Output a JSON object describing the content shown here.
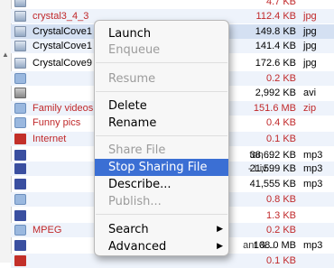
{
  "files": [
    {
      "name": "",
      "size": "4.7 KB",
      "type": "",
      "icon": "image-icon",
      "style": "red"
    },
    {
      "name": "crystal3_4_3",
      "size": "112.4 KB",
      "type": "jpg",
      "icon": "image-icon",
      "style": "red"
    },
    {
      "name": "CrystalCove1",
      "size": "149.8 KB",
      "type": "jpg",
      "icon": "image-icon",
      "style": "normal"
    },
    {
      "name": "CrystalCove1",
      "size": "141.4 KB",
      "type": "jpg",
      "icon": "image-icon",
      "style": "normal"
    },
    {
      "name": "CrystalCove9",
      "size": "172.6 KB",
      "type": "jpg",
      "icon": "image-icon",
      "style": "normal"
    },
    {
      "name": "",
      "size": "0.2 KB",
      "type": "",
      "icon": "folder-icon",
      "style": "red"
    },
    {
      "name": "",
      "size": "2,992 KB",
      "type": "avi",
      "icon": "video-icon",
      "style": "normal"
    },
    {
      "name": "Family videos",
      "size": "151.6 MB",
      "type": "zip",
      "icon": "folder-icon",
      "style": "red"
    },
    {
      "name": "Funny pics",
      "size": "0.4 KB",
      "type": "",
      "icon": "folder-icon",
      "style": "red"
    },
    {
      "name": "Internet",
      "size": "0.1 KB",
      "type": "",
      "icon": "red-file-icon",
      "style": "red"
    },
    {
      "name": "",
      "size": "38,692 KB",
      "type": "mp3",
      "icon": "audio-icon",
      "style": "normal",
      "mid": "tan ..."
    },
    {
      "name": "",
      "size": "21,599 KB",
      "type": "mp3",
      "icon": "audio-icon",
      "style": "normal",
      "mid": "- Liv..."
    },
    {
      "name": "",
      "size": "41,555 KB",
      "type": "mp3",
      "icon": "audio-icon",
      "style": "normal",
      "mid": ""
    },
    {
      "name": "",
      "size": "0.8 KB",
      "type": "",
      "icon": "folder-icon",
      "style": "red"
    },
    {
      "name": "",
      "size": "1.3 KB",
      "type": "",
      "icon": "mp3-file-icon",
      "style": "red"
    },
    {
      "name": "MPEG",
      "size": "0.2 KB",
      "type": "",
      "icon": "folder-icon",
      "style": "red"
    },
    {
      "name": "",
      "size": "108.0 MB",
      "type": "mp3",
      "icon": "audio-icon",
      "style": "normal",
      "mid": "ant &..."
    },
    {
      "name": "",
      "size": "0.1 KB",
      "type": "",
      "icon": "red-file-icon",
      "style": "red"
    }
  ],
  "context_menu": {
    "items": [
      {
        "label": "Launch",
        "enabled": true
      },
      {
        "label": "Enqueue",
        "enabled": false
      },
      {
        "label": "Resume",
        "enabled": false
      },
      {
        "label": "Delete",
        "enabled": true
      },
      {
        "label": "Rename",
        "enabled": true
      },
      {
        "label": "Share File",
        "enabled": false
      },
      {
        "label": "Stop Sharing File",
        "enabled": true,
        "highlighted": true
      },
      {
        "label": "Describe...",
        "enabled": true
      },
      {
        "label": "Publish...",
        "enabled": false
      },
      {
        "label": "Search",
        "enabled": true,
        "submenu": true
      },
      {
        "label": "Advanced",
        "enabled": true,
        "submenu": true
      }
    ]
  },
  "colors": {
    "highlight": "#3b6fd4",
    "red_text": "#c0282a",
    "selected_row": "#d4e0f2"
  }
}
